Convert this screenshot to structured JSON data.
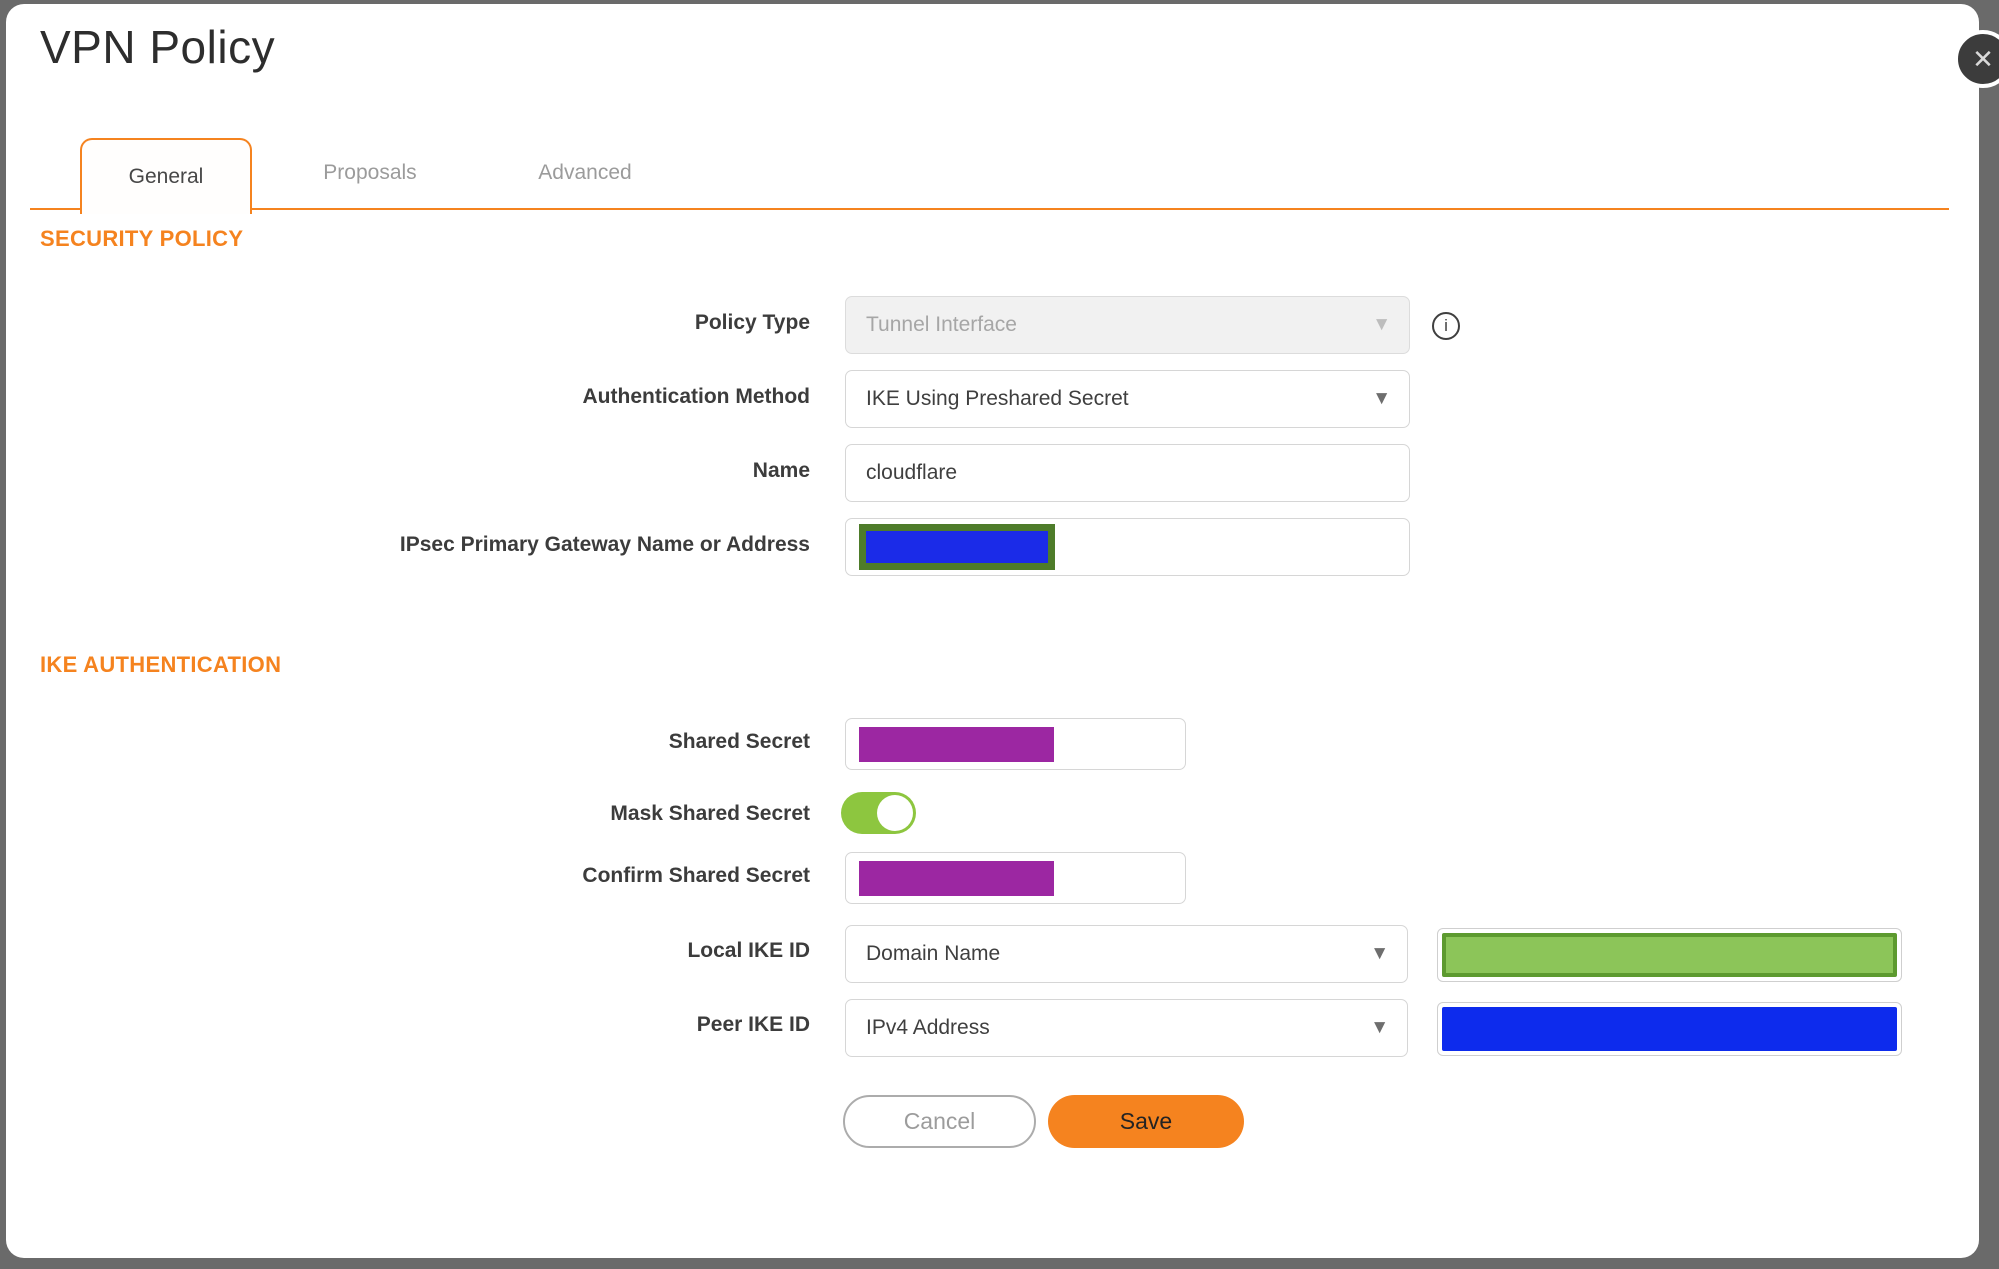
{
  "theme": {
    "accent": "#F5831F",
    "backdrop": "#6A6A6A",
    "label-text": "#3C3C3C",
    "value-text": "#3F3F3F",
    "muted-text": "#9B9B9B",
    "field-border": "#D6D6D6",
    "disabled-bg": "#F1F1F1",
    "disabled-text": "#A6A6A6",
    "redact-purple": "#9C27A2",
    "redact-blue": "#1B2BE8",
    "redact-blue-2": "#0D2BED",
    "redact-green": "#8CC559",
    "redact-green-border": "#5D9A2F",
    "redact-olive-border": "#4E7C2A",
    "toggle-on": "#8DC63F",
    "save-text": "#232323"
  },
  "icons": {
    "close": "✕",
    "chevron_down": "▼",
    "info": "i"
  },
  "dialog": {
    "title": "VPN Policy"
  },
  "tabs": [
    {
      "label": "General",
      "active": true
    },
    {
      "label": "Proposals",
      "active": false
    },
    {
      "label": "Advanced",
      "active": false
    }
  ],
  "security_policy": {
    "heading": "SECURITY POLICY",
    "policy_type": {
      "label": "Policy Type",
      "value": "Tunnel Interface",
      "state": "disabled"
    },
    "auth_method": {
      "label": "Authentication Method",
      "value": "IKE Using Preshared Secret"
    },
    "name": {
      "label": "Name",
      "value": "cloudflare"
    },
    "gateway": {
      "label": "IPsec Primary Gateway Name or Address",
      "value": ""
    }
  },
  "ike_authentication": {
    "heading": "IKE AUTHENTICATION",
    "shared_secret": {
      "label": "Shared Secret",
      "value": ""
    },
    "mask_shared_secret": {
      "label": "Mask Shared Secret",
      "state": "on"
    },
    "confirm_shared_secret": {
      "label": "Confirm Shared Secret",
      "value": ""
    },
    "local_ike_id": {
      "label": "Local IKE ID",
      "value": "Domain Name"
    },
    "peer_ike_id": {
      "label": "Peer IKE ID",
      "value": "IPv4 Address"
    }
  },
  "actions": {
    "cancel": "Cancel",
    "save": "Save"
  }
}
